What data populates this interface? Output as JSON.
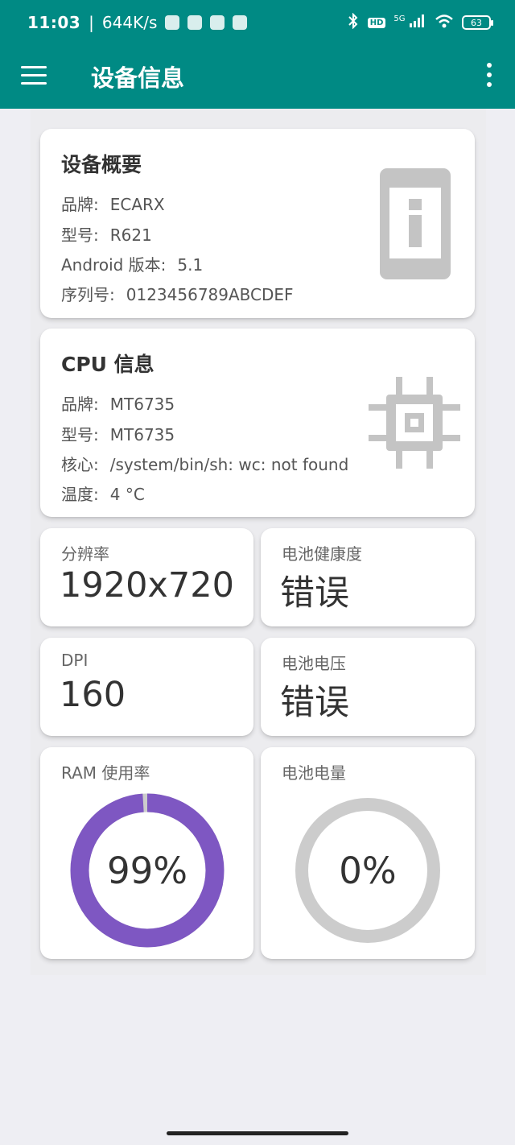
{
  "status_bar": {
    "time": "11:03",
    "speed": "644K/s",
    "signal": "5G",
    "battery": "63"
  },
  "app_bar": {
    "title": "设备信息"
  },
  "device_card": {
    "title": "设备概要",
    "icon": "device-info-icon",
    "rows": [
      {
        "key": "品牌:",
        "value": "ECARX"
      },
      {
        "key": "型号:",
        "value": "R621"
      },
      {
        "key": "Android 版本:",
        "value": "5.1"
      },
      {
        "key": "序列号:",
        "value": "0123456789ABCDEF"
      }
    ]
  },
  "cpu_card": {
    "title": "CPU 信息",
    "icon": "cpu-chip-icon",
    "rows": [
      {
        "key": "品牌:",
        "value": "MT6735"
      },
      {
        "key": "型号:",
        "value": "MT6735"
      },
      {
        "key": "核心:",
        "value": "/system/bin/sh: wc: not found"
      },
      {
        "key": "温度:",
        "value": "4 °C"
      }
    ]
  },
  "stats": {
    "resolution": {
      "label": "分辨率",
      "value": "1920x720"
    },
    "battery_health": {
      "label": "电池健康度",
      "value": "错误"
    },
    "dpi": {
      "label": "DPI",
      "value": "160"
    },
    "battery_voltage": {
      "label": "电池电压",
      "value": "错误"
    },
    "ram": {
      "label": "RAM 使用率",
      "value": "99%",
      "percent": 99
    },
    "battery_level": {
      "label": "电池电量",
      "value": "0%",
      "percent": 0
    }
  },
  "colors": {
    "primary": "#008a84",
    "ram_ring": "#7e57c2",
    "ring_track": "#cccccc",
    "icon_gray": "#c4c4c4"
  }
}
